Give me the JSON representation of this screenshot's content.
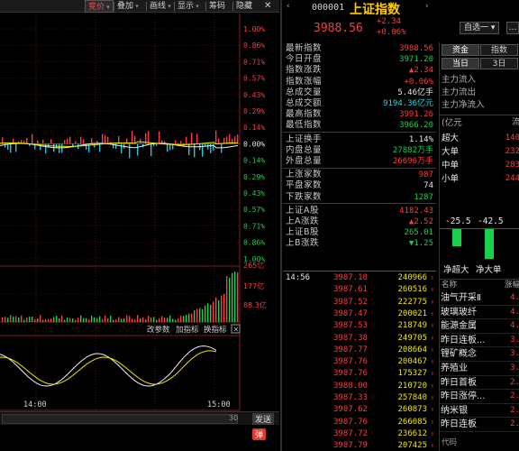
{
  "toolbar": {
    "items": [
      "竞价",
      "叠加",
      "画线",
      "显示",
      "筹码",
      "隐藏"
    ],
    "active_index": 0
  },
  "chart": {
    "percent_labels_top": [
      "1.00%",
      "0.86%",
      "0.71%",
      "0.57%",
      "0.43%",
      "0.29%",
      "0.14%",
      "0.00%",
      "0.14%",
      "0.29%",
      "0.43%",
      "0.57%",
      "0.71%",
      "0.86%",
      "1.00%"
    ],
    "volume_labels": [
      "265亿",
      "177亿",
      "88.3亿"
    ],
    "indicator_tools": [
      "改参数",
      "加指标",
      "换指标"
    ],
    "time_labels": [
      "14:00",
      "15:00"
    ],
    "input_value": "30",
    "send_label": "发送",
    "danmu_label": "弹"
  },
  "header": {
    "code": "000001",
    "name": "上证指数",
    "price": "3988.56",
    "change": "+2.34",
    "change_pct": "+0.06%",
    "watchlist_label": "自选一",
    "colors": {
      "up": "#ff3b3b",
      "down": "#19d14a",
      "name": "#ffcc00"
    }
  },
  "quote": [
    {
      "label": "最新指数",
      "value": "3988.56",
      "color": "red"
    },
    {
      "label": "今日开盘",
      "value": "3971.20",
      "color": "green"
    },
    {
      "label": "指数涨跌",
      "value": "▲2.34",
      "color": "red"
    },
    {
      "label": "指数涨幅",
      "value": "+0.06%",
      "color": "red"
    },
    {
      "label": "总成交量",
      "value": "5.46亿手",
      "color": "white"
    },
    {
      "label": "总成交额",
      "value": "9194.36亿元",
      "color": "cyan"
    },
    {
      "label": "最高指数",
      "value": "3991.26",
      "color": "red"
    },
    {
      "label": "最低指数",
      "value": "3966.20",
      "color": "green"
    },
    {
      "label": "上证换手",
      "value": "1.14%",
      "color": "white"
    },
    {
      "label": "内盘总量",
      "value": "27882万手",
      "color": "green"
    },
    {
      "label": "外盘总量",
      "value": "26696万手",
      "color": "red"
    },
    {
      "label": "上涨家数",
      "value": "987",
      "color": "red"
    },
    {
      "label": "平盘家数",
      "value": "74",
      "color": "white"
    },
    {
      "label": "下跌家数",
      "value": "1287",
      "color": "green"
    },
    {
      "label": "上证A股",
      "value": "4182.43",
      "color": "red"
    },
    {
      "label": "上A涨跌",
      "value": "▲2.52",
      "color": "red"
    },
    {
      "label": "上证B股",
      "value": "265.01",
      "color": "green"
    },
    {
      "label": "上B涨跌",
      "value": "▼1.25",
      "color": "green"
    }
  ],
  "trades": [
    {
      "time": "14:56",
      "price": "3987.18",
      "volume": "240966"
    },
    {
      "time": "",
      "price": "3987.61",
      "volume": "260516"
    },
    {
      "time": "",
      "price": "3987.52",
      "volume": "222775"
    },
    {
      "time": "",
      "price": "3987.47",
      "volume": "200021"
    },
    {
      "time": "",
      "price": "3987.53",
      "volume": "218749"
    },
    {
      "time": "",
      "price": "3987.38",
      "volume": "249705"
    },
    {
      "time": "",
      "price": "3987.77",
      "volume": "208664"
    },
    {
      "time": "",
      "price": "3987.76",
      "volume": "200467"
    },
    {
      "time": "",
      "price": "3987.76",
      "volume": "175327"
    },
    {
      "time": "",
      "price": "3988.00",
      "volume": "210720"
    },
    {
      "time": "",
      "price": "3987.33",
      "volume": "257840"
    },
    {
      "time": "",
      "price": "3987.62",
      "volume": "260873"
    },
    {
      "time": "",
      "price": "3987.76",
      "volume": "266085"
    },
    {
      "time": "",
      "price": "3987.72",
      "volume": "236612"
    },
    {
      "time": "",
      "price": "3987.79",
      "volume": "207425"
    }
  ],
  "capital": {
    "tabs_row1": [
      "资金",
      "指数"
    ],
    "tabs_row2": [
      "当日",
      "3日"
    ],
    "flow_labels": [
      "主力流入",
      "主力流出",
      "主力净流入"
    ],
    "unit": "(亿元",
    "unit_right": "流",
    "order_rows": [
      {
        "label": "超大",
        "value": "140"
      },
      {
        "label": "大单",
        "value": "232"
      },
      {
        "label": "中单",
        "value": "283"
      },
      {
        "label": "小单",
        "value": "244"
      }
    ],
    "bar_values": [
      "-25.5",
      "-42.5"
    ],
    "bar_labels": [
      "净超大",
      "净大单"
    ],
    "sector_header": [
      "名称",
      "涨幅"
    ],
    "sectors": [
      {
        "name": "油气开采Ⅱ",
        "value": "4."
      },
      {
        "name": "玻璃玻纤",
        "value": "4."
      },
      {
        "name": "能源金属",
        "value": "4."
      },
      {
        "name": "昨日连板...",
        "value": "3."
      },
      {
        "name": "锂矿概念",
        "value": "3."
      },
      {
        "name": "养殖业",
        "value": "3."
      },
      {
        "name": "昨日首板",
        "value": "2."
      },
      {
        "name": "昨日涨停...",
        "value": "2."
      },
      {
        "name": "纳米银",
        "value": "2."
      },
      {
        "name": "昨日连板",
        "value": "2."
      }
    ],
    "bottom_header": "代码"
  }
}
